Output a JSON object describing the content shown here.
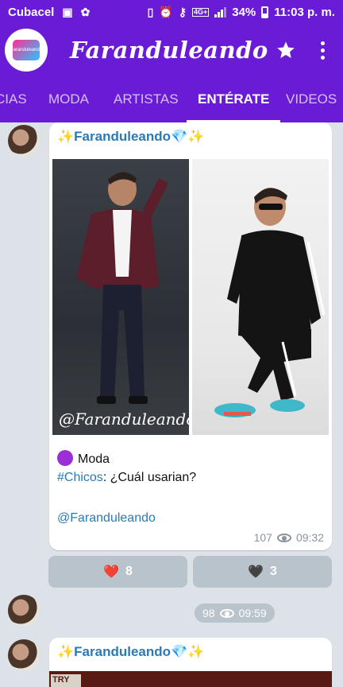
{
  "status_bar": {
    "carrier": "Cubacel",
    "battery": "34%",
    "time": "11:03 p. m.",
    "network_label": "4G+"
  },
  "app_bar": {
    "title": "Faranduleando",
    "logo_text": "Faranduleando"
  },
  "tabs": [
    {
      "label": "CIAS"
    },
    {
      "label": "MODA"
    },
    {
      "label": "ARTISTAS"
    },
    {
      "label": "ENTÉRATE",
      "active": true
    },
    {
      "label": "VIDEOS"
    }
  ],
  "post1": {
    "title": "✨Faranduleando💎✨",
    "watermark": "@Faranduleando",
    "category": "Moda",
    "hashtag": "#Chicos",
    "question": ": ¿Cuál usarian?",
    "signature": "@Faranduleando",
    "views": "107",
    "time": "09:32",
    "reactions": [
      {
        "emoji": "❤️",
        "count": "8"
      },
      {
        "emoji": "🖤",
        "count": "3"
      }
    ]
  },
  "post2": {
    "views": "98",
    "time": "09:59"
  },
  "post3": {
    "title": "✨Faranduleando💎✨",
    "photo_text": "TRY ME"
  },
  "colors": {
    "primary": "#6a1bd6",
    "link": "#2a7ab6",
    "background": "#dde2e8",
    "reaction_bg": "#b8c3cc"
  }
}
